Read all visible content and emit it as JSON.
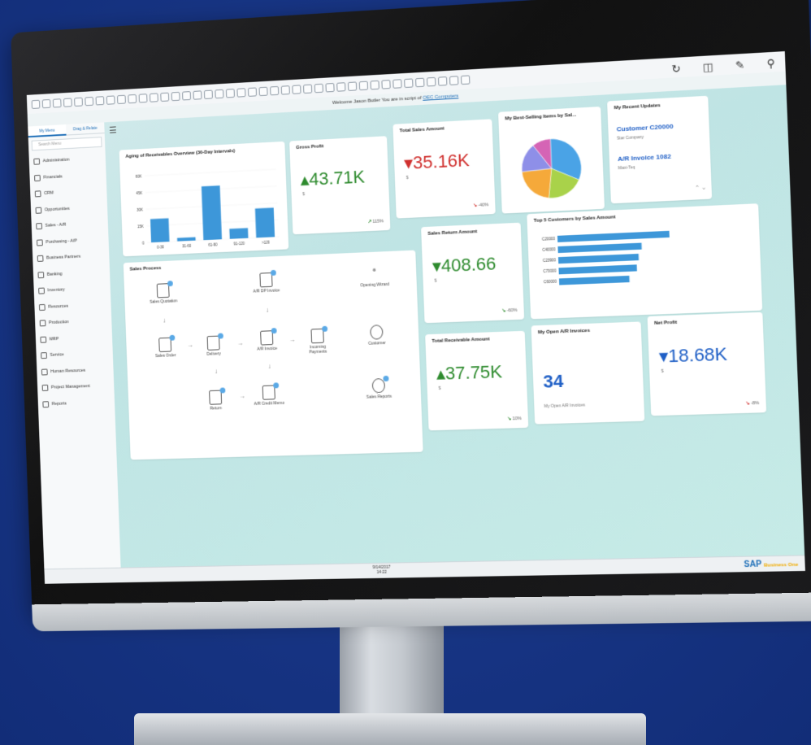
{
  "welcome": {
    "prefix": "Welcome Jason Butler You are in script of",
    "company": "OEC Computers"
  },
  "sidebar": {
    "tabs": [
      "My Menu",
      "Drag & Relate"
    ],
    "search_placeholder": "Search Menu",
    "items": [
      "Administration",
      "Financials",
      "CRM",
      "Opportunities",
      "Sales - A/R",
      "Purchasing - A/P",
      "Business Partners",
      "Banking",
      "Inventory",
      "Resources",
      "Production",
      "MRP",
      "Service",
      "Human Resources",
      "Project Management",
      "Reports"
    ]
  },
  "cards": {
    "aging": {
      "title": "Aging of Receivables Overview (30-Day Intervals)",
      "chart_data": {
        "type": "bar",
        "categories": [
          "0-30",
          "31-60",
          "61-90",
          "91-120",
          ">120"
        ],
        "values": [
          21,
          3,
          48,
          9,
          26
        ],
        "ylim": [
          0,
          60
        ],
        "yticks": [
          "60K",
          "45K",
          "30K",
          "15K",
          "0"
        ]
      }
    },
    "gross_profit": {
      "title": "Gross Profit",
      "value": "43.71K",
      "currency": "$",
      "trend": "115%"
    },
    "total_sales": {
      "title": "Total Sales Amount",
      "value": "35.16K",
      "currency": "$",
      "trend": "-40%"
    },
    "best_selling": {
      "title": "My Best-Selling Items by Sal...",
      "chart_data": {
        "type": "pie",
        "slices": [
          {
            "value": 32,
            "color": "#4aa3e6"
          },
          {
            "value": 20,
            "color": "#a9d24a"
          },
          {
            "value": 22,
            "color": "#f5a93a"
          },
          {
            "value": 16,
            "color": "#8e8fe8"
          },
          {
            "value": 10,
            "color": "#d564b5"
          }
        ]
      }
    },
    "recent_updates": {
      "title": "My Recent Updates",
      "items": [
        {
          "title": "Customer C20000",
          "sub": "Star Company"
        },
        {
          "title": "A/R Invoice 1082",
          "sub": "Maxi-Teq"
        }
      ]
    },
    "sales_return": {
      "title": "Sales Return Amount",
      "value": "408.66",
      "currency": "$",
      "trend": "-60%"
    },
    "top_customers": {
      "title": "Top 5 Customers by Sales Amount",
      "chart_data": {
        "type": "bar",
        "orientation": "horizontal",
        "categories": [
          "C20000",
          "C40000",
          "C23900",
          "C70000",
          "C60000"
        ],
        "values": [
          100,
          75,
          72,
          70,
          63
        ]
      }
    },
    "sales_process": {
      "title": "Sales Process",
      "nodes": [
        "Sales Quotation",
        "A/R DP Invoice",
        "Opening Wizard",
        "Sales Order",
        "Delivery",
        "A/R Invoice",
        "Incoming Payments",
        "Customer",
        "Return",
        "A/R Credit Memo",
        "Sales Reports"
      ]
    },
    "total_receivable": {
      "title": "Total Receivable Amount",
      "value": "37.75K",
      "currency": "$",
      "trend": "10%"
    },
    "open_ar": {
      "title": "My Open A/R Invoices",
      "value": "34",
      "sub": "My Open A/R Invoices"
    },
    "net_profit": {
      "title": "Net Profit",
      "value": "18.68K",
      "currency": "$",
      "trend": "-8%"
    }
  },
  "status": {
    "date": "9/14/2017",
    "time": "14:22"
  },
  "brand": {
    "name": "SAP",
    "sub": "Business One"
  }
}
